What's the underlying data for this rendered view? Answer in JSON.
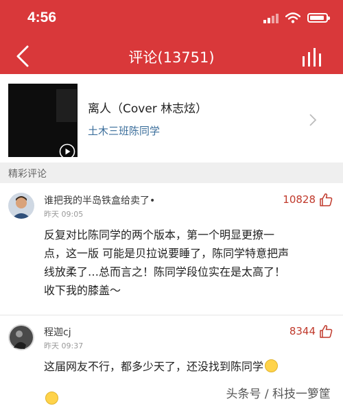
{
  "status_bar": {
    "time": "4:56",
    "signal_bars_on": 2,
    "signal_bars_total": 4,
    "battery_level": 0.7
  },
  "header": {
    "title": "评论(13751)",
    "back_icon": "chevron-left-icon",
    "chart_icon": "bar-chart-icon"
  },
  "song": {
    "title": "离人（Cover 林志炫）",
    "artist": "土木三班陈同学"
  },
  "section": {
    "label": "精彩评论"
  },
  "comments": [
    {
      "username": "谁把我的半岛铁盒给卖了•",
      "time": "昨天 09:05",
      "likes": "10828",
      "lines": [
        "反复对比陈同学的两个版本，第一个明显更撩一",
        "点，这一版 可能是贝拉说要睡了，陈同学特意把声",
        "线放柔了…总而言之！陈同学段位实在是太高了！",
        "收下我的膝盖～"
      ]
    },
    {
      "username": "程迦cj",
      "time": "昨天 09:37",
      "likes": "8344",
      "text": "这届网友不行，都多少天了，还没找到陈同学"
    }
  ],
  "watermark": "头条号 / 科技一箩筐",
  "colors": {
    "header_bg": "#d9383a",
    "artist_link": "#3b6e9b",
    "likes": "#c0392b"
  }
}
